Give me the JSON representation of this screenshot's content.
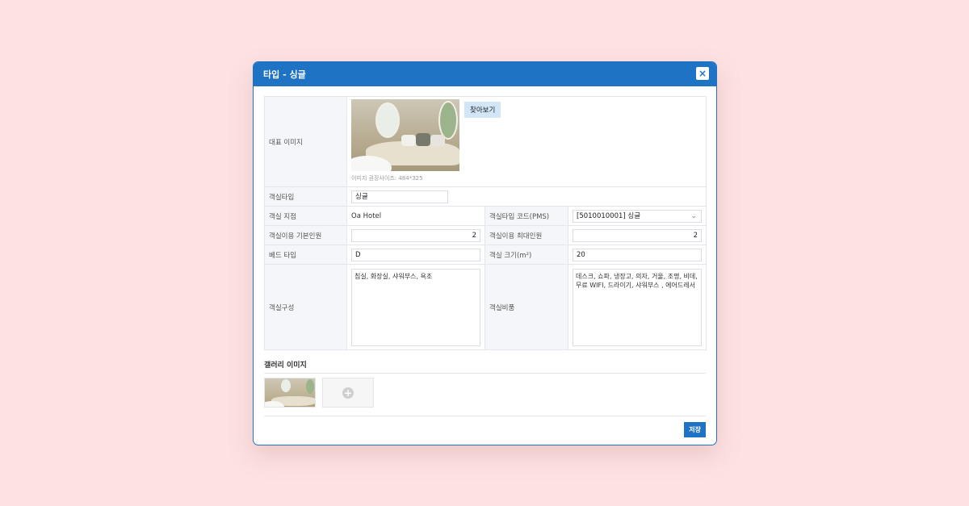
{
  "modal": {
    "title": "타입 - 싱글",
    "close_label": "×"
  },
  "form": {
    "image": {
      "label": "대표 이미지",
      "find_button": "찾아보기",
      "hint": "이미지 권장사이즈: 484*325"
    },
    "room_type": {
      "label": "객실타입",
      "value": "싱글"
    },
    "branch": {
      "label": "객실 지점",
      "value": "Oa Hotel"
    },
    "pms_code": {
      "label": "객실타입 코드(PMS)",
      "value": "[5010010001] 싱글"
    },
    "base_occupancy": {
      "label": "객실이용 기본인원",
      "value": "2"
    },
    "max_occupancy": {
      "label": "객실이용 최대인원",
      "value": "2"
    },
    "bed_type": {
      "label": "베드 타입",
      "value": "D"
    },
    "room_size": {
      "label": "객실 크기(m²)",
      "value": "20"
    },
    "composition": {
      "label": "객실구성",
      "value": "침실, 화장실, 샤워부스, 욕조"
    },
    "amenities": {
      "label": "객실비품",
      "value": "데스크, 쇼파, 냉장고, 의자, 거울, 조명, 비데, 무료 WIFI, 드라이기, 샤워부스 , 에어드레서"
    }
  },
  "gallery": {
    "title": "갤러리 이미지",
    "add_symbol": "+"
  },
  "footer": {
    "save_label": "저장"
  },
  "colors": {
    "accent": "#1f73c4",
    "background": "#fde2e2"
  }
}
